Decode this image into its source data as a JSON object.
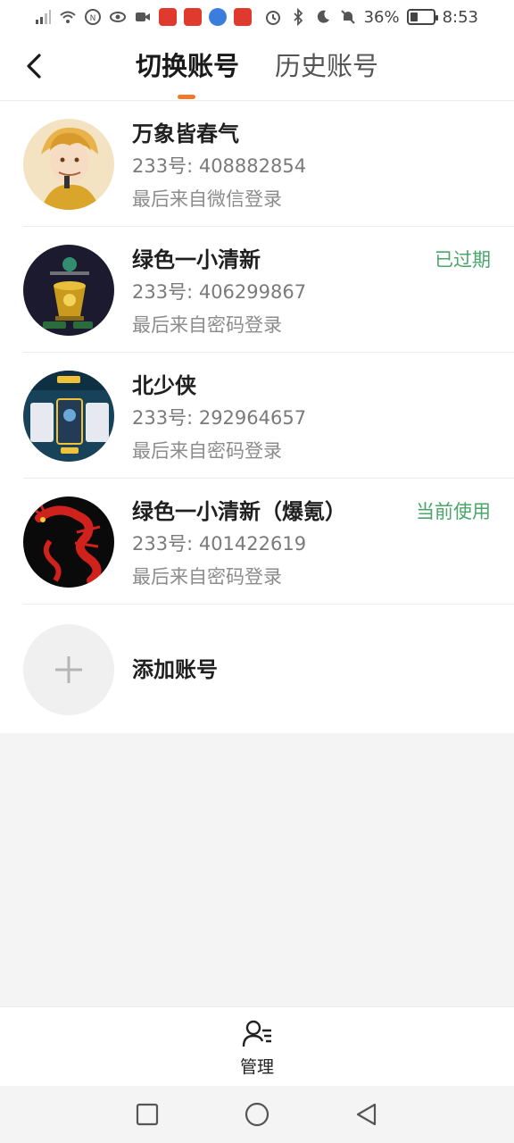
{
  "status_bar": {
    "battery_percent": "36%",
    "time": "8:53",
    "battery_level": 0.36
  },
  "header": {
    "tabs": [
      {
        "label": "切换账号",
        "active": true
      },
      {
        "label": "历史账号",
        "active": false
      }
    ],
    "accent_color": "#f07a2b"
  },
  "accounts": [
    {
      "name": "万象皆春气",
      "id_line": "233号: 408882854",
      "login": "最后来自微信登录",
      "status": ""
    },
    {
      "name": "绿色一小清新",
      "id_line": "233号: 406299867",
      "login": "最后来自密码登录",
      "status": "已过期"
    },
    {
      "name": "北少侠",
      "id_line": "233号: 292964657",
      "login": "最后来自密码登录",
      "status": ""
    },
    {
      "name": "绿色一小清新（爆氪）",
      "id_line": "233号: 401422619",
      "login": "最后来自密码登录",
      "status": "当前使用"
    }
  ],
  "add_account": {
    "label": "添加账号"
  },
  "manage": {
    "label": "管理"
  },
  "colors": {
    "status_green": "#4aa669",
    "background": "#f4f4f4"
  }
}
